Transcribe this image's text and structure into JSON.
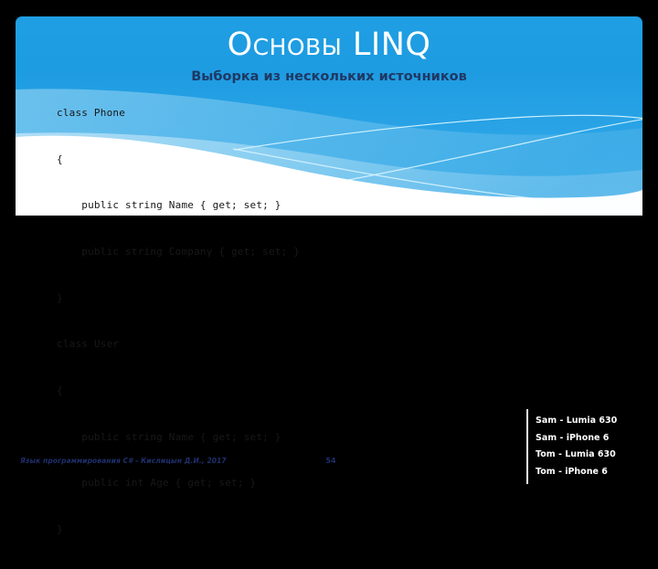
{
  "slide": {
    "title": "Основы LINQ",
    "subtitle": "Выборка из нескольких источников",
    "number": "54",
    "footer": "Язык программирования C# - Кислицын Д.И., 2017"
  },
  "code": {
    "lines": [
      "class Phone",
      "{",
      "    public string Name { get; set; }",
      "    public string Company { get; set; }",
      "}",
      "class User",
      "{",
      "    public string Name { get; set; }",
      "    public int Age { get; set; }",
      "}"
    ]
  },
  "console": {
    "lines": [
      "Sam - Lumia 630",
      "Sam - iPhone 6",
      "Tom - Lumia 630",
      "Tom - iPhone 6"
    ]
  },
  "colors": {
    "background": "#000000",
    "slide_blue_top": "#1f9ee3",
    "slide_blue_bottom": "#38ace9",
    "title_text": "#ffffff",
    "subtitle_text": "#1f3864",
    "footer_text": "#1f2f6e",
    "code_text": "#17181a",
    "console_text": "#ffffff",
    "wave_white": "#ffffff",
    "wave_light_blue": "#8ed2f2",
    "wave_line": "#ccf3ff"
  }
}
